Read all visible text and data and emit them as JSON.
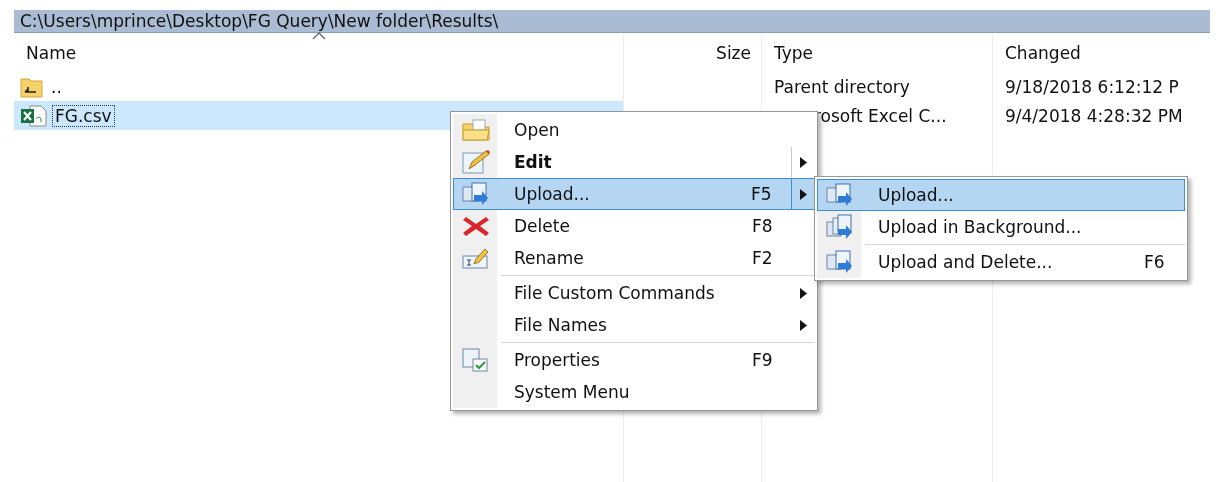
{
  "path_bar": {
    "text": "C:\\Users\\mprince\\Desktop\\FG Query\\New folder\\Results\\"
  },
  "file_list": {
    "columns": [
      {
        "label": "Name",
        "sorted": true
      },
      {
        "label": "Size",
        "sorted": false
      },
      {
        "label": "Type",
        "sorted": false
      },
      {
        "label": "Changed",
        "sorted": false
      }
    ],
    "rows": [
      {
        "name": "..",
        "kind": "parent",
        "type": "Parent directory",
        "changed": "9/18/2018  6:12:12 P",
        "selected": false
      },
      {
        "name": "FG.csv",
        "kind": "excel",
        "type": "rosoft Excel C...",
        "changed": "9/4/2018  4:28:32 PM",
        "selected": true
      }
    ]
  },
  "context_menu": {
    "items": [
      {
        "kind": "item",
        "label": "Open",
        "bold": false,
        "selected": false,
        "has_submenu": false
      },
      {
        "kind": "item",
        "label": "Edit",
        "bold": true,
        "selected": false,
        "has_submenu": true
      },
      {
        "kind": "item",
        "label": "Upload...",
        "shortcut": "F5",
        "bold": false,
        "selected": true,
        "has_submenu": true
      },
      {
        "kind": "item",
        "label": "Delete",
        "shortcut": "F8",
        "bold": false,
        "selected": false,
        "has_submenu": false
      },
      {
        "kind": "item",
        "label": "Rename",
        "shortcut": "F2",
        "bold": false,
        "selected": false,
        "has_submenu": false
      },
      {
        "kind": "separator"
      },
      {
        "kind": "item",
        "label": "File Custom Commands",
        "bold": false,
        "selected": false,
        "has_submenu": true
      },
      {
        "kind": "item",
        "label": "File Names",
        "bold": false,
        "selected": false,
        "has_submenu": true
      },
      {
        "kind": "separator"
      },
      {
        "kind": "item",
        "label": "Properties",
        "shortcut": "F9",
        "bold": false,
        "selected": false,
        "has_submenu": false
      },
      {
        "kind": "item",
        "label": "System Menu",
        "bold": false,
        "selected": false,
        "has_submenu": false
      }
    ]
  },
  "submenu": {
    "items": [
      {
        "kind": "item",
        "label": "Upload...",
        "bold": false,
        "selected": true,
        "has_submenu": false
      },
      {
        "kind": "item",
        "label": "Upload in Background...",
        "bold": false,
        "selected": false,
        "has_submenu": false
      },
      {
        "kind": "separator"
      },
      {
        "kind": "item",
        "label": "Upload and Delete...",
        "shortcut": "F6",
        "bold": false,
        "selected": false,
        "has_submenu": false
      }
    ]
  }
}
